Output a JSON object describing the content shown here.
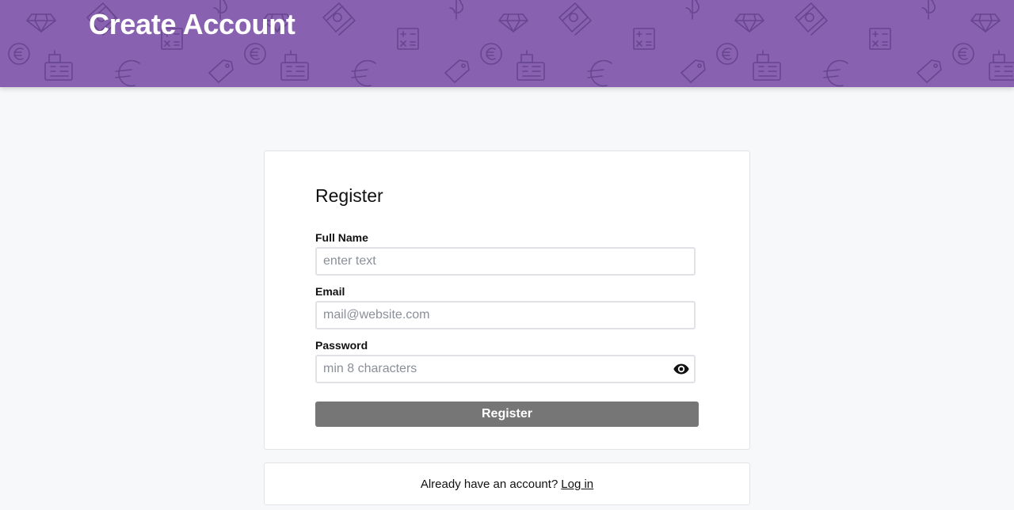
{
  "header": {
    "title": "Create Account",
    "background_color": "#8862b0",
    "pattern_icons": [
      "diamond-icon",
      "euro-coin-icon",
      "cash-register-icon",
      "banknote-icon",
      "calculator-icon",
      "dollar-sign-icon",
      "price-tag-icon",
      "euro-sign-icon"
    ]
  },
  "form": {
    "title": "Register",
    "full_name": {
      "label": "Full Name",
      "placeholder": "enter text",
      "value": ""
    },
    "email": {
      "label": "Email",
      "placeholder": "mail@website.com",
      "value": ""
    },
    "password": {
      "label": "Password",
      "placeholder": "min 8 characters",
      "value": "",
      "toggle_icon": "eye-icon"
    },
    "submit_label": "Register",
    "submit_color": "#767676"
  },
  "footer": {
    "prompt": "Already have an account?",
    "login_link": "Log in"
  }
}
